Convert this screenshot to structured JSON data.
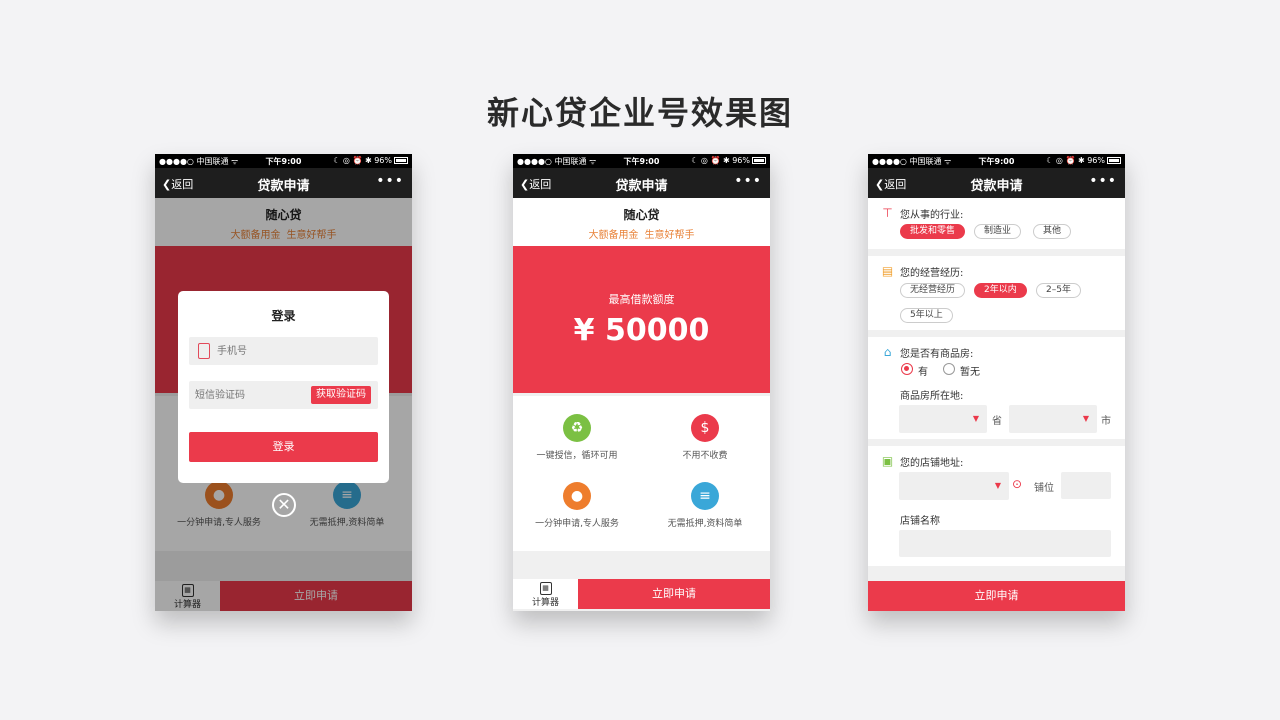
{
  "page": {
    "title": "新心贷企业号效果图"
  },
  "status_bar": {
    "carrier": "●●●●○ 中国联通 ᯤ",
    "time": "下午9:00",
    "right": "☾ ◎ ⏰ ✱ 96%"
  },
  "nav": {
    "back_label": "返回",
    "title": "贷款申请",
    "more": "•••"
  },
  "hero": {
    "brand": "随心贷",
    "tag1": "大额备用金",
    "tag2": "生意好帮手"
  },
  "loan": {
    "max_label": "最高借款额度",
    "max_amount": "¥ 50000"
  },
  "features": [
    {
      "text": "一键授信，循环可用",
      "icon": "recycle-icon",
      "color": "#7bc043",
      "glyph": "♻"
    },
    {
      "text": "不用不收费",
      "icon": "coin-hand-icon",
      "color": "#eb3a4b",
      "glyph": "$"
    },
    {
      "text": "一分钟申请,专人服务",
      "icon": "person-icon",
      "color": "#ee7d2d",
      "glyph": "●"
    },
    {
      "text": "无需抵押,资料简单",
      "icon": "document-icon",
      "color": "#3aa7d8",
      "glyph": "≡"
    }
  ],
  "bottom": {
    "calc_label": "计算器",
    "apply_label": "立即申请"
  },
  "login_modal": {
    "title": "登录",
    "phone_placeholder": "手机号",
    "code_placeholder": "短信验证码",
    "get_code_label": "获取验证码",
    "login_label": "登录",
    "close_glyph": "✕"
  },
  "form": {
    "industry": {
      "label": "您从事的行业:",
      "options": [
        "批发和零售",
        "制造业",
        "其他"
      ],
      "selected": "批发和零售"
    },
    "experience": {
      "label": "您的经营经历:",
      "options": [
        "无经营经历",
        "2年以内",
        "2–5年",
        "5年以上"
      ],
      "selected": "2年以内"
    },
    "property": {
      "label": "您是否有商品房:",
      "yes": "有",
      "no": "暂无",
      "selected": "有",
      "location_label": "商品房所在地:",
      "province_unit": "省",
      "city_unit": "市"
    },
    "store": {
      "label": "您的店铺地址:",
      "stall_label": "铺位",
      "name_label": "店铺名称"
    }
  },
  "colors": {
    "brand_red": "#eb3a4b",
    "orange_text": "#e8833a"
  }
}
